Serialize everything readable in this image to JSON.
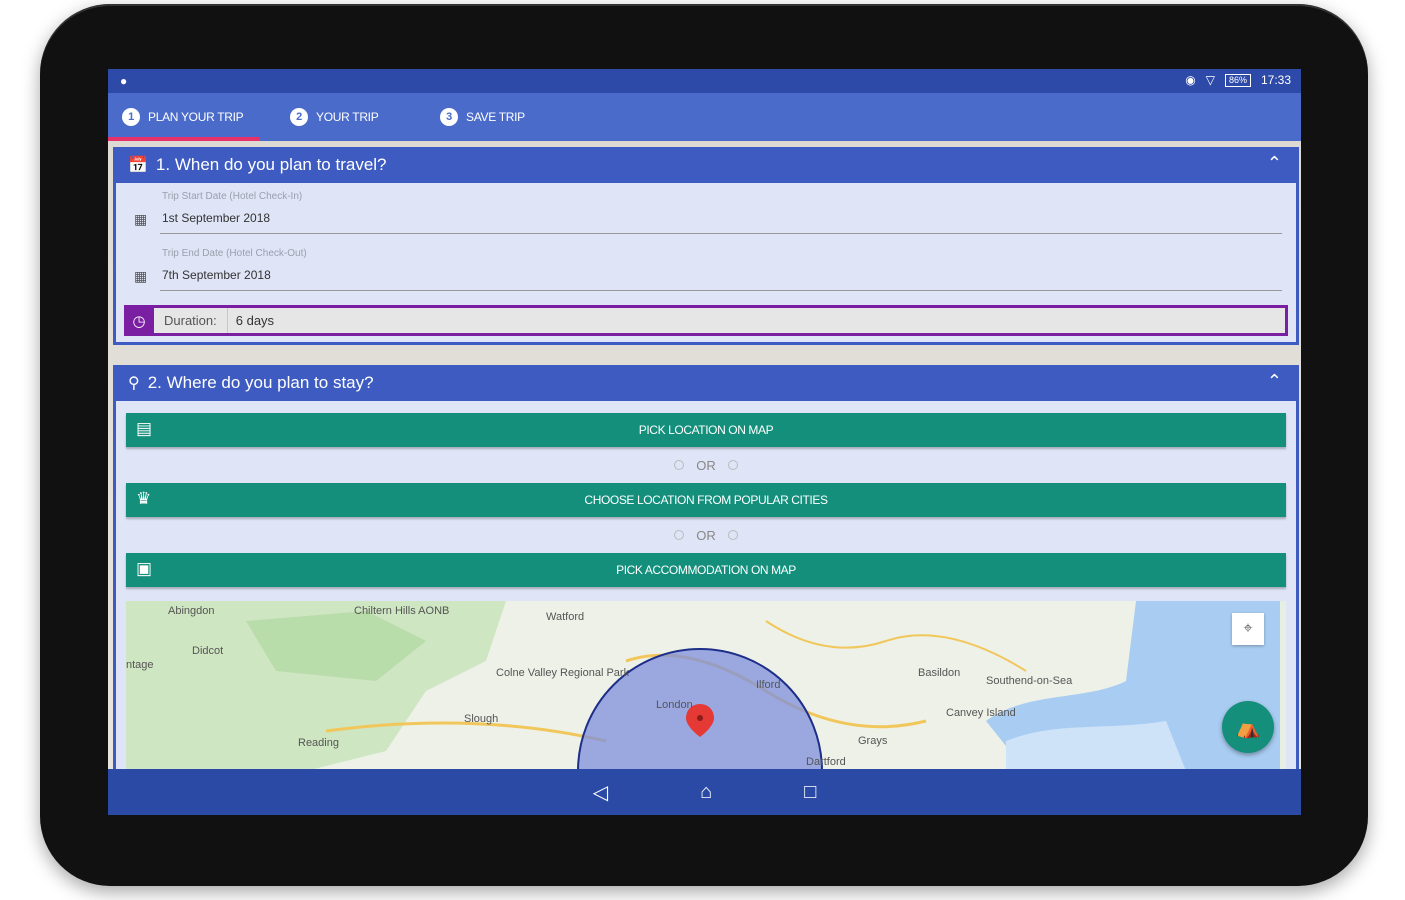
{
  "status_bar": {
    "left_icon": "location-pin-icon",
    "time": "17:33",
    "battery": "86%"
  },
  "tabs": [
    {
      "num": "1",
      "label": "PLAN YOUR TRIP"
    },
    {
      "num": "2",
      "label": "YOUR TRIP"
    },
    {
      "num": "3",
      "label": "SAVE TRIP"
    }
  ],
  "section1": {
    "title": "1. When do you plan to travel?",
    "start_label": "Trip Start Date (Hotel Check-In)",
    "start_value": "1st September 2018",
    "end_label": "Trip End Date (Hotel Check-Out)",
    "end_value": "7th September 2018",
    "duration_label": "Duration:",
    "duration_value": "6 days"
  },
  "section2": {
    "title": "2. Where do you plan to stay?",
    "btn_pick_map": "PICK LOCATION ON MAP",
    "or1": "OR",
    "btn_popular": "CHOOSE LOCATION FROM POPULAR CITIES",
    "or2": "OR",
    "btn_accommodation": "PICK ACCOMMODATION ON MAP"
  },
  "map_labels": {
    "abingdon": "Abingdon",
    "chiltern": "Chiltern Hills AONB",
    "watford": "Watford",
    "didcot": "Didcot",
    "colne": "Colne Valley Regional Park",
    "london": "London",
    "slough": "Slough",
    "reading": "Reading",
    "basildon": "Basildon",
    "southend": "Southend-on-Sea",
    "canvey": "Canvey Island",
    "grays": "Grays",
    "dartford": "Dartford",
    "ilford": "Ilford",
    "stage": "ntage"
  },
  "colors": {
    "primary": "#3d5bc0",
    "tab_bg": "#4a6bc9",
    "tab_indicator": "#e8316b",
    "button_green": "#138f7c",
    "duration_purple": "#7a1fa2",
    "map_circle": "#6a7fd6"
  }
}
